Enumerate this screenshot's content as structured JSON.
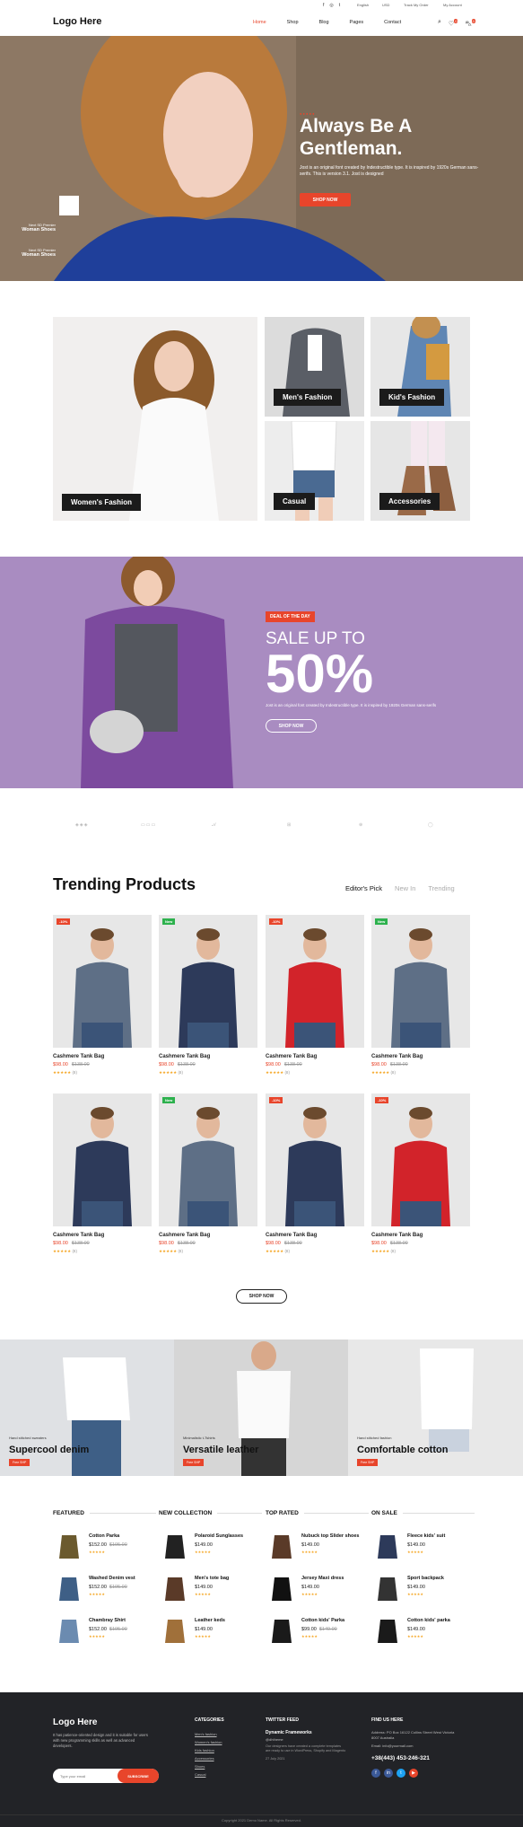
{
  "topbar": {
    "currency": "English",
    "language": "USD",
    "track_order": "Track My Order",
    "account": "My Account"
  },
  "header": {
    "logo": "Logo Here",
    "nav": [
      "Home",
      "Shop",
      "Blog",
      "Pages",
      "Contact"
    ],
    "wishlist_count": "0",
    "cart_count": "0",
    "accent": "#e8452b"
  },
  "hero": {
    "title_line1": "Always Be A",
    "title_line2": "Gentleman.",
    "text": "Jost is an original font created by Indestructible type. It is inspired by 1920s German sans-serifs. This is version 3.1. Jost is designed",
    "button": "SHOP NOW",
    "side_items": [
      {
        "title": "Next SD Premier",
        "subtitle": "Woman Shoes"
      },
      {
        "title": "Next SD Premier",
        "subtitle": "Woman Shoes"
      }
    ]
  },
  "categories": {
    "women": "Women's Fashion",
    "men": "Men's Fashion",
    "kids": "Kid's Fashion",
    "casual": "Casual",
    "accessories": "Accessories"
  },
  "deal": {
    "tag": "DEAL OF THE DAY",
    "sale_text": "SALE UP TO",
    "percent": "50%",
    "text": "Jost is an original font created by Indestructible type. It is inspired by 1920s German sans-serifs",
    "button": "SHOP NOW"
  },
  "trending": {
    "title": "Trending Products",
    "tabs": [
      "Editor's Pick",
      "New In",
      "Trending"
    ],
    "products": [
      {
        "name": "Cashmere Tank Bag",
        "price": "$98.00",
        "old": "$138.00",
        "badge": "-10%",
        "badge_color": "#e8452b",
        "stars": "★★★★★",
        "count": "(8)"
      },
      {
        "name": "Cashmere Tank Bag",
        "price": "$98.00",
        "old": "$138.00",
        "badge": "New",
        "badge_color": "#2db14d",
        "stars": "★★★★★",
        "count": "(8)"
      },
      {
        "name": "Cashmere Tank Bag",
        "price": "$98.00",
        "old": "$138.00",
        "badge": "-10%",
        "badge_color": "#e8452b",
        "stars": "★★★★★",
        "count": "(8)"
      },
      {
        "name": "Cashmere Tank Bag",
        "price": "$98.00",
        "old": "$138.00",
        "badge": "New",
        "badge_color": "#2db14d",
        "stars": "★★★★★",
        "count": "(8)"
      },
      {
        "name": "Cashmere Tank Bag",
        "price": "$98.00",
        "old": "$138.00",
        "badge": "",
        "badge_color": "#e8452b",
        "stars": "★★★★★",
        "count": "(8)"
      },
      {
        "name": "Cashmere Tank Bag",
        "price": "$98.00",
        "old": "$138.00",
        "badge": "New",
        "badge_color": "#2db14d",
        "stars": "★★★★★",
        "count": "(8)"
      },
      {
        "name": "Cashmere Tank Bag",
        "price": "$98.00",
        "old": "$138.00",
        "badge": "-10%",
        "badge_color": "#e8452b",
        "stars": "★★★★★",
        "count": "(8)"
      },
      {
        "name": "Cashmere Tank Bag",
        "price": "$98.00",
        "old": "$138.00",
        "badge": "-10%",
        "badge_color": "#e8452b",
        "stars": "★★★★★",
        "count": "(8)"
      }
    ],
    "button": "SHOP NOW"
  },
  "banners": [
    {
      "small": "Hand stitched sweaters",
      "title": "Supercool denim",
      "button": "Free SHP"
    },
    {
      "small": "Minimalistic t-Tshirts",
      "title": "Versatile leather",
      "button": "Free SHP"
    },
    {
      "small": "Hand stitched fashion",
      "title": "Comfortable cotton",
      "button": "Free SHP"
    }
  ],
  "lists": [
    {
      "heading": "FEATURED",
      "items": [
        {
          "name": "Cotton Parka",
          "price": "$152.00",
          "old": "$195.00"
        },
        {
          "name": "Washed Denim vest",
          "price": "$152.00",
          "old": "$195.00"
        },
        {
          "name": "Chambray Shirt",
          "price": "$152.00",
          "old": "$195.00"
        }
      ]
    },
    {
      "heading": "NEW COLLECTION",
      "items": [
        {
          "name": "Polaroid Sunglasses",
          "price": "$149.00",
          "old": ""
        },
        {
          "name": "Men's tote bag",
          "price": "$149.00",
          "old": ""
        },
        {
          "name": "Leather keds",
          "price": "$149.00",
          "old": ""
        }
      ]
    },
    {
      "heading": "TOP RATED",
      "items": [
        {
          "name": "Nubuck top Slider shoes",
          "price": "$149.00",
          "old": ""
        },
        {
          "name": "Jersey Maxi dress",
          "price": "$149.00",
          "old": ""
        },
        {
          "name": "Cotton kids' Parka",
          "price": "$99.00",
          "old": "$149.00"
        }
      ]
    },
    {
      "heading": "ON SALE",
      "items": [
        {
          "name": "Fleece kids' suit",
          "price": "$149.00",
          "old": ""
        },
        {
          "name": "Sport backpack",
          "price": "$149.00",
          "old": ""
        },
        {
          "name": "Cotton kids' parka",
          "price": "$149.00",
          "old": ""
        }
      ]
    }
  ],
  "footer": {
    "logo": "Logo Here",
    "about": "It has patience-oriented design and it is suitable for users with new programming skills as well as advanced developers.",
    "email_placeholder": "Type your email",
    "subscribe": "SUBSCRIBE",
    "categories_title": "CATEGORIES",
    "categories": [
      "Men's fashion",
      "Women's fashion",
      "Kids fashion",
      "Accessories",
      "Shoes",
      "Casual"
    ],
    "twitter_title": "TWITTER FEED",
    "tweet_title": "Dynamic Frameworks",
    "tweet_handle": "@dhtheme",
    "tweet_text": "Our designers have created a complete templates are ready to use in WordPress, Shopify and Magento",
    "tweet_date": "27 July 2021",
    "contact_title": "FIND US HERE",
    "address": "Address: PO Box 16122 Collins Street West Victoria 8007 Australia",
    "email": "Email: info@yourmail.com",
    "phone": "+38(443) 453-246-321",
    "copyright": "Copyright 2021 Demo Name. All Rights Reserved."
  }
}
